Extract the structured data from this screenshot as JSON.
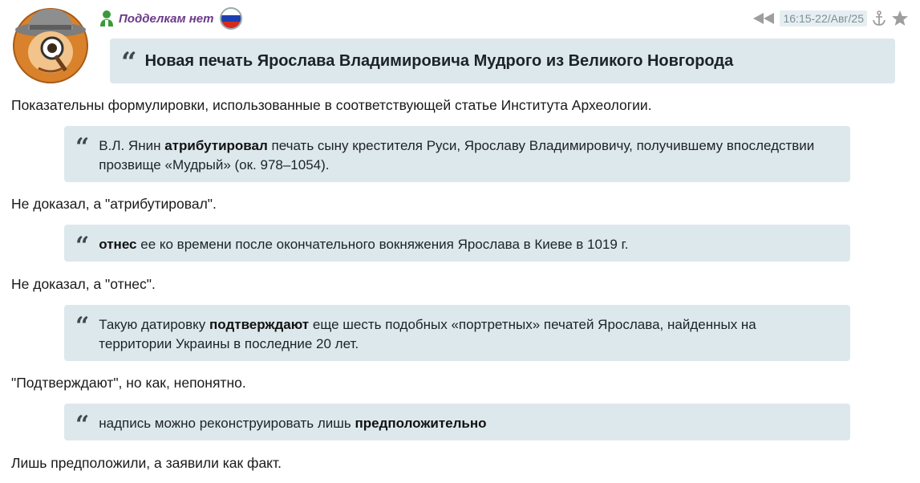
{
  "post": {
    "username": "Подделкам нет",
    "timestamp": "16:15-22/Авг/25",
    "title": "Новая печать Ярослава Владимировича Мудрого из Великого Новгорода"
  },
  "content": {
    "intro": "Показательны формулировки, использованные в соответствующей статье Института Археологии.",
    "q1": {
      "pre": "В.Л. Янин ",
      "strong": "атрибутировал",
      "post": " печать сыну крестителя Руси, Ярославу Владимировичу, получившему впоследствии прозвище «Мудрый» (ок. 978–1054)."
    },
    "c1": "Не доказал, а \"атрибутировал\".",
    "q2": {
      "strong": "отнес",
      "post": " ее ко времени после окончательного вокняжения Ярослава в Киеве в 1019 г."
    },
    "c2": "Не доказал, а \"отнес\".",
    "q3": {
      "pre": "Такую датировку ",
      "strong": "подтверждают",
      "post": " еще шесть подобных «портретных» печатей Ярослава, найденных на территории Украины в последние 20 лет."
    },
    "c3": "\"Подтверждают\", но как, непонятно.",
    "q4": {
      "pre": "надпись можно реконструировать лишь ",
      "strong": "предположительно"
    },
    "c4": "Лишь предположили, а заявили как факт."
  },
  "icons": {
    "avatar": "detective-avatar",
    "user": "user-icon",
    "flag": "russia-flag-icon",
    "rewind": "rewind-icon",
    "anchor": "anchor-icon",
    "star": "star-icon"
  },
  "colors": {
    "quote_bg": "#dde8ec",
    "username": "#6b3a8a",
    "timestamp_bg": "#e7eef1"
  }
}
